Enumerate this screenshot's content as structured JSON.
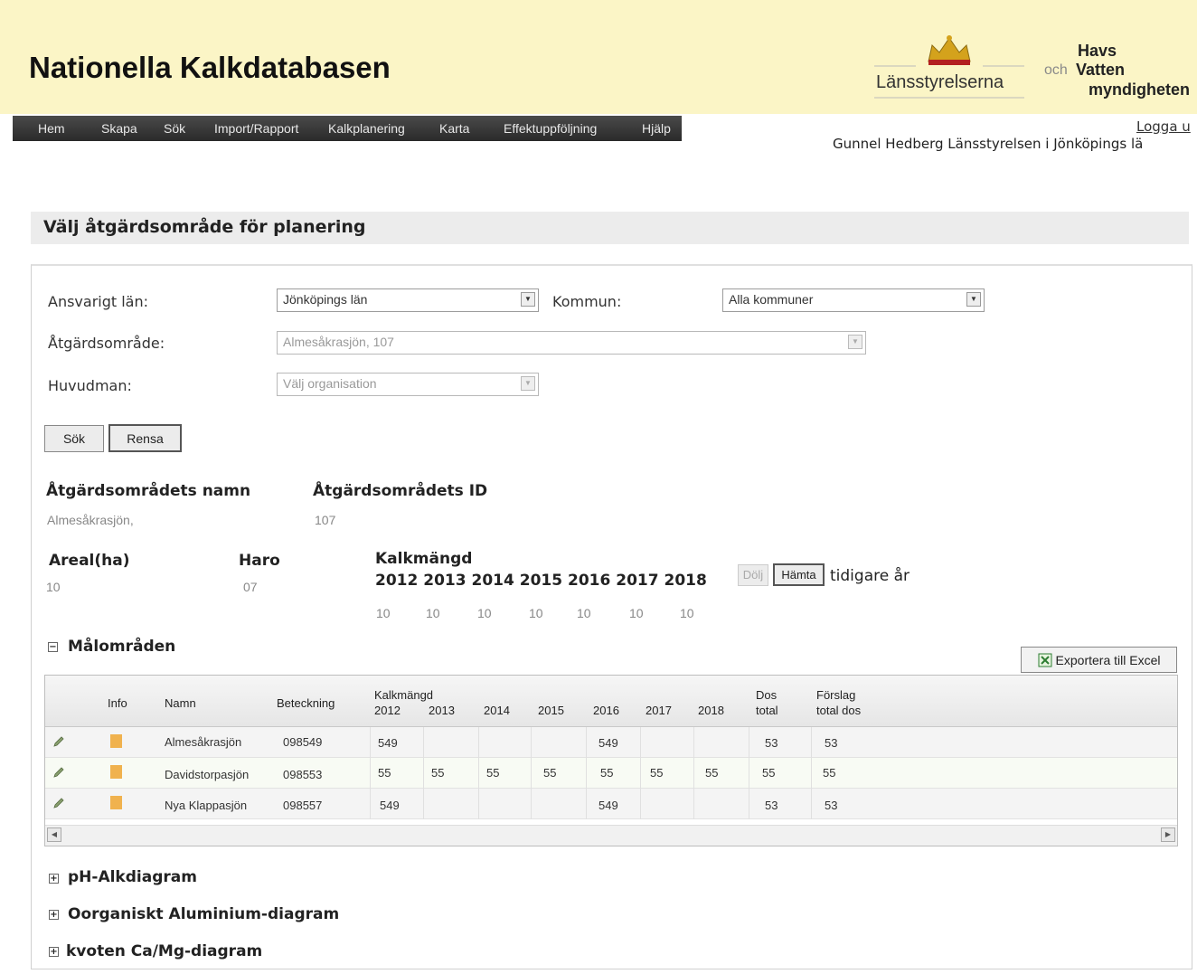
{
  "header": {
    "site_title": "Nationella Kalkdatabasen",
    "lansstyrelserna": "Länsstyrelserna",
    "och": "och",
    "havs_line1": "Havs",
    "havs_line2": "Vatten",
    "havs_line3": "myndigheten"
  },
  "nav": {
    "items": [
      "Hem",
      "Skapa",
      "Sök",
      "Import/Rapport",
      "Kalkplanering",
      "Karta",
      "Effektuppföljning",
      "Hjälp"
    ]
  },
  "user": {
    "logout": "Logga u",
    "user_line": "Gunnel Hedberg Länsstyrelsen i Jönköpings lä"
  },
  "page": {
    "title": "Välj åtgärdsområde för planering"
  },
  "form": {
    "lan_label": "Ansvarigt län:",
    "lan_value": "Jönköpings län",
    "kommun_label": "Kommun:",
    "kommun_value": "Alla kommuner",
    "atgard_label": "Åtgärdsområde:",
    "atgard_value": "Almesåkrasjön, 107",
    "huvudman_label": "Huvudman:",
    "huvudman_value": "Välj organisation",
    "search_button": "Sök",
    "clear_button": "Rensa"
  },
  "info": {
    "name_label": "Åtgärdsområdets namn",
    "name_value": "Almesåkrasjön,",
    "id_label": "Åtgärdsområdets ID",
    "id_value": "107",
    "areal_label": "Areal(ha)",
    "areal_value": "10",
    "haro_label": "Haro",
    "haro_value": "07",
    "kalkmangd_label": "Kalkmängd",
    "years": [
      "2012",
      "2013",
      "2014",
      "2015",
      "2016",
      "2017",
      "2018"
    ],
    "year_values": [
      "10",
      "10",
      "10",
      "10",
      "10",
      "10",
      "10"
    ],
    "hide_button": "Dölj",
    "fetch_button": "Hämta",
    "earlier_years": "tidigare år"
  },
  "malomraden": {
    "title": "Målområden",
    "toggle": "−",
    "export_button": "Exportera till Excel",
    "headers": {
      "info": "Info",
      "namn": "Namn",
      "beteckning": "Beteckning",
      "kalkmangd": "Kalkmängd",
      "years": [
        "2012",
        "2013",
        "2014",
        "2015",
        "2016",
        "2017",
        "2018"
      ],
      "dos_line1": "Dos",
      "dos_line2": "total",
      "forslag_line1": "Förslag",
      "forslag_line2": "total dos"
    },
    "rows": [
      {
        "namn": "Almesåkrasjön",
        "beteckning": "098549",
        "y2012": "549",
        "y2013": "",
        "y2014": "",
        "y2015": "",
        "y2016": "549",
        "y2017": "",
        "y2018": "",
        "dos": "53",
        "forslag": "53"
      },
      {
        "namn": "Davidstorpasjön",
        "beteckning": "098553",
        "y2012": "55",
        "y2013": "55",
        "y2014": "55",
        "y2015": "55",
        "y2016": "55",
        "y2017": "55",
        "y2018": "55",
        "dos": "55",
        "forslag": "55"
      },
      {
        "namn": "Nya Klappasjön",
        "beteckning": "098557",
        "y2012": "549",
        "y2013": "",
        "y2014": "",
        "y2015": "",
        "y2016": "549",
        "y2017": "",
        "y2018": "",
        "dos": "53",
        "forslag": "53"
      }
    ]
  },
  "sections": [
    {
      "title": "pH-Alkdiagram",
      "toggle": "+"
    },
    {
      "title": "Oorganiskt Aluminium-diagram",
      "toggle": "+"
    },
    {
      "title": "kvoten Ca/Mg-diagram",
      "toggle": "+"
    }
  ],
  "colors": {
    "header_bg": "#fbf5c6",
    "nav_bg": "#333333",
    "heading_bar": "#ececec"
  }
}
